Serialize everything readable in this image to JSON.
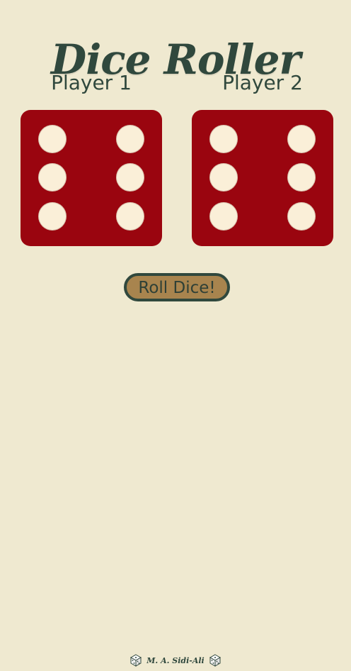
{
  "title": "Dice Roller",
  "players": [
    {
      "label": "Player 1",
      "die_value": 6
    },
    {
      "label": "Player 2",
      "die_value": 6
    }
  ],
  "roll_button": {
    "label": "Roll Dice!"
  },
  "footer": {
    "author": "M. A. Sidi-Ali",
    "left_icon": "dice-icon",
    "right_icon": "dice-icon"
  },
  "colors": {
    "background": "#efe9d0",
    "die": "#9a050f",
    "pip": "#faefd8",
    "text": "#30483d",
    "button": "#a8844e"
  }
}
